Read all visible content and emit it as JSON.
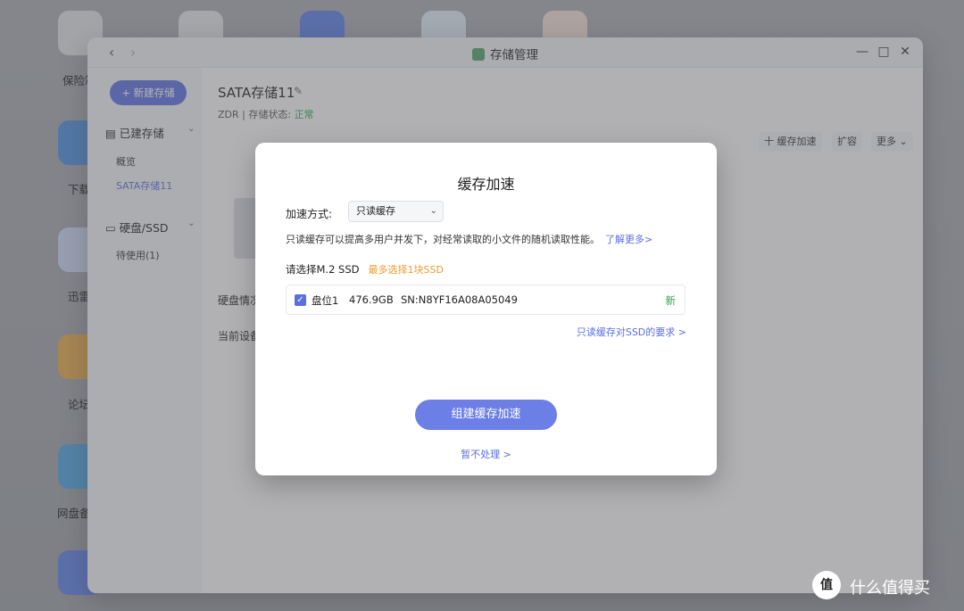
{
  "desktop": {
    "labels": [
      "保险箱",
      "下载",
      "迅雷",
      "论坛",
      "网盘备"
    ]
  },
  "window": {
    "title": "存储管理",
    "nav_back": "‹",
    "nav_forward": "›",
    "minimize": "—",
    "maximize": "□",
    "close": "✕"
  },
  "sidebar": {
    "new_button": "+ 新建存储",
    "group_storage": "已建存储",
    "items_storage": [
      "概览",
      "SATA存储11"
    ],
    "group_disk": "硬盘/SSD",
    "items_disk": [
      "待使用(1)"
    ]
  },
  "main": {
    "title": "SATA存储11",
    "meta_prefix": "ZDR | 存储状态:",
    "meta_status": "正常",
    "actions": [
      "十 缓存加速",
      "扩容",
      "更多 ⌄"
    ],
    "line1": "硬盘情况",
    "line2": "当前设备"
  },
  "dialog": {
    "title": "缓存加速",
    "mode_label": "加速方式:",
    "mode_value": "只读缓存",
    "description": "只读缓存可以提高多用户并发下，对经常读取的小文件的随机读取性能。",
    "learn_more": "了解更多>",
    "choose_label": "请选择M.2 SSD",
    "choose_hint": "最多选择1块SSD",
    "ssd": {
      "slot": "盘位1",
      "size": "476.9GB",
      "sn": "SN:N8YF16A08A05049",
      "status": "新",
      "checked": true
    },
    "requirements_link": "只读缓存对SSD的要求 >",
    "primary_button": "组建缓存加速",
    "secondary_link": "暂不处理 >"
  },
  "watermark": {
    "icon": "值",
    "text": "什么值得买"
  },
  "colors": {
    "accent": "#5a6fe0",
    "status_ok": "#2ea44f",
    "hint": "#f29b2c"
  }
}
